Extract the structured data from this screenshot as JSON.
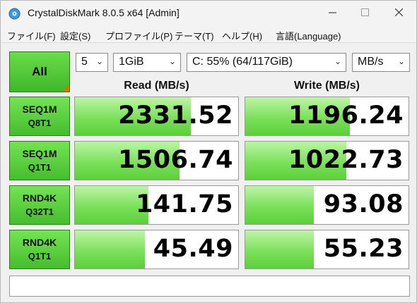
{
  "window": {
    "title": "CrystalDiskMark 8.0.5 x64 [Admin]"
  },
  "menu": [
    "ファイル(F)",
    "設定(S)",
    "プロファイル(P)",
    "テーマ(T)",
    "ヘルプ(H)",
    "言語(Language)"
  ],
  "controls": {
    "all_label": "All",
    "count": "5",
    "size": "1GiB",
    "drive": "C: 55% (64/117GiB)",
    "unit": "MB/s"
  },
  "headers": {
    "read": "Read (MB/s)",
    "write": "Write (MB/s)"
  },
  "rows": [
    {
      "line1": "SEQ1M",
      "line2": "Q8T1",
      "read": "2331.52",
      "write": "1196.24",
      "read_fill": 0.71,
      "write_fill": 0.64
    },
    {
      "line1": "SEQ1M",
      "line2": "Q1T1",
      "read": "1506.74",
      "write": "1022.73",
      "read_fill": 0.64,
      "write_fill": 0.62
    },
    {
      "line1": "RND4K",
      "line2": "Q32T1",
      "read": "141.75",
      "write": "93.08",
      "read_fill": 0.45,
      "write_fill": 0.42
    },
    {
      "line1": "RND4K",
      "line2": "Q1T1",
      "read": "45.49",
      "write": "55.23",
      "read_fill": 0.43,
      "write_fill": 0.42
    }
  ],
  "colors": {
    "accent_green": "#45bd2e",
    "bar_green": "#7be05a",
    "corner_orange": "#e07000"
  },
  "icons": {
    "app": "crystaldiskmark-disk-icon",
    "minimize": "minimize-icon",
    "maximize": "maximize-icon",
    "close": "close-icon"
  }
}
